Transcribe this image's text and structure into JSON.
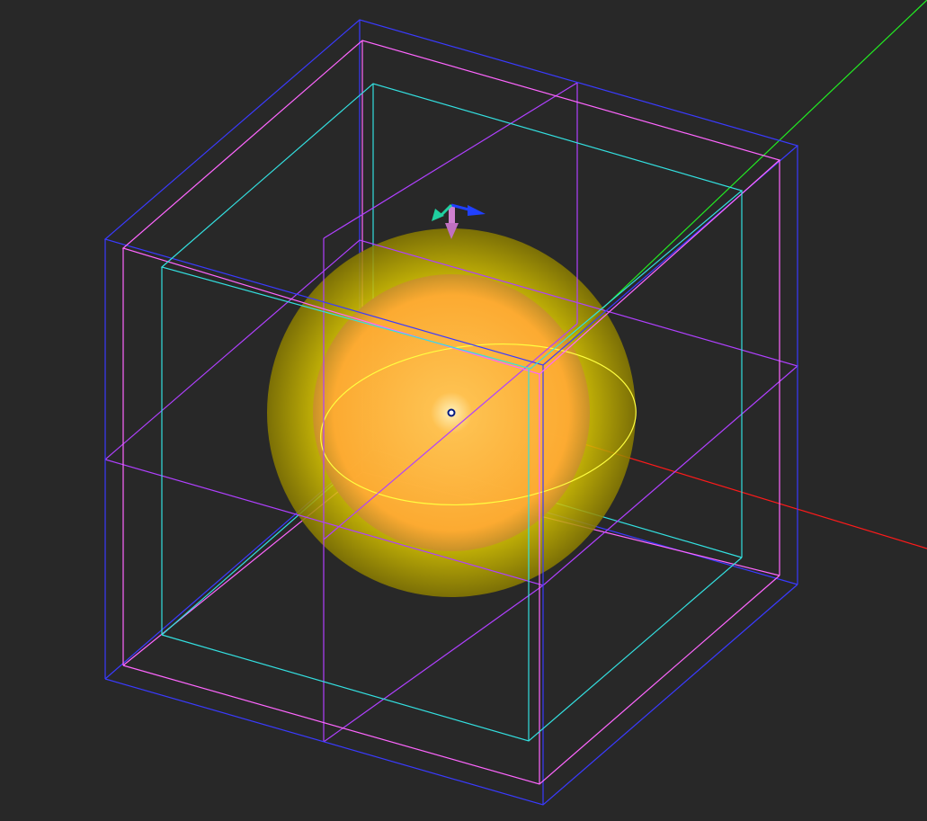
{
  "viewport": {
    "background": "#282828",
    "colors": {
      "outer_box": "#3a3aff",
      "middle_box": "#ff66ff",
      "inner_box": "#33e0e0",
      "mid_planes": "#b040ff",
      "outer_sphere": "#d4c400",
      "inner_sphere": "#ffaa33",
      "equator": "#ffff40",
      "x_axis": "#ff1a1a",
      "y_axis": "#22ee22"
    },
    "gizmo": {
      "icons": [
        "move-arrow-z-icon",
        "move-arrow-x-icon",
        "move-arrow-y-icon"
      ]
    }
  }
}
